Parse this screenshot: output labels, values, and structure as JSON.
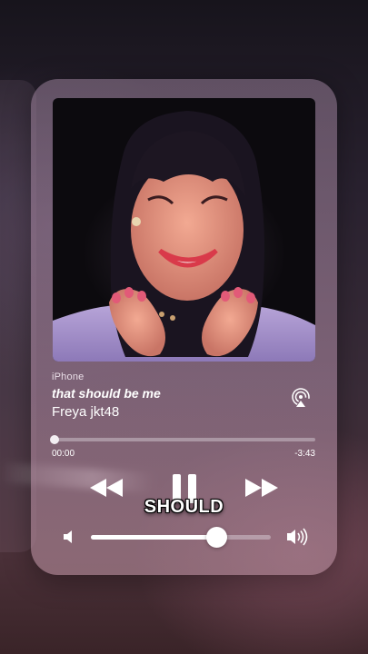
{
  "player": {
    "source": "iPhone",
    "title": "that should be me",
    "artist": "Freya jkt48",
    "elapsed": "00:00",
    "remaining": "-3:43",
    "progress_fraction": 0.01,
    "volume_fraction": 0.7
  },
  "overlay": {
    "lyric": "SHOULD"
  },
  "icons": {
    "airplay": "airplay-icon",
    "rewind": "rewind-icon",
    "pause": "pause-icon",
    "forward": "fast-forward-icon",
    "volume_low": "volume-low-icon",
    "volume_high": "volume-high-icon"
  },
  "colors": {
    "card": "#a587a0",
    "accent": "#ffffff"
  }
}
